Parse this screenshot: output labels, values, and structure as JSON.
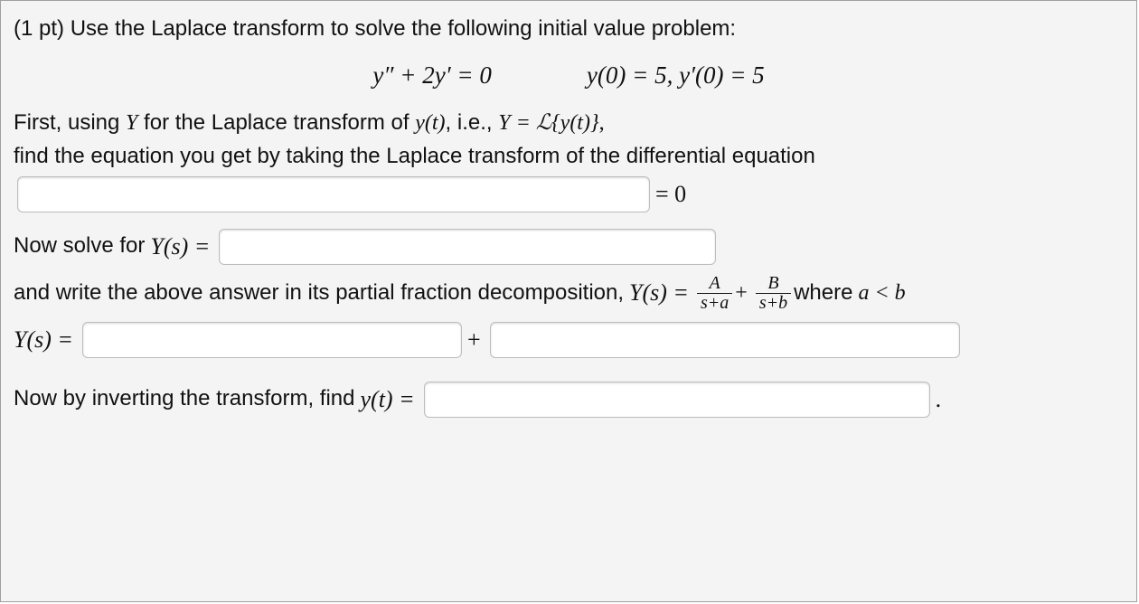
{
  "problem": {
    "points_prefix": "(1 pt) ",
    "intro": "Use the Laplace transform to solve the following initial value problem:",
    "ode_lhs": "y″ + 2y′ = 0",
    "ivs": "y(0) = 5,  y′(0) = 5",
    "step1_line1_pre": "First, using ",
    "step1_Y": "Y",
    "step1_line1_mid": " for the Laplace transform of ",
    "step1_yt": "y(t)",
    "step1_line1_post": ", i.e., ",
    "step1_YeqL": "Y = ",
    "step1_Lsym": "ℒ",
    "step1_Lbraces": "{y(t)}",
    "step1_comma": ",",
    "step1_line2": "find the equation you get by taking the Laplace transform of the differential equation",
    "equals_zero": " = 0",
    "step2_pre": "Now solve for ",
    "step2_Ys": "Y(s) = ",
    "step3_pre": "and write the above answer in its partial fraction decomposition, ",
    "step3_Ys": "Y(s) = ",
    "step3_fracA_num": "A",
    "step3_fracA_den": "s+a",
    "step3_plus": " + ",
    "step3_fracB_num": "B",
    "step3_fracB_den": "s+b",
    "step3_where": " where ",
    "step3_altb": "a < b",
    "step4_Ys": "Y(s) = ",
    "step4_plus": " + ",
    "step5_pre": "Now by inverting the transform, find ",
    "step5_yt": "y(t) = ",
    "step5_period": " ."
  }
}
